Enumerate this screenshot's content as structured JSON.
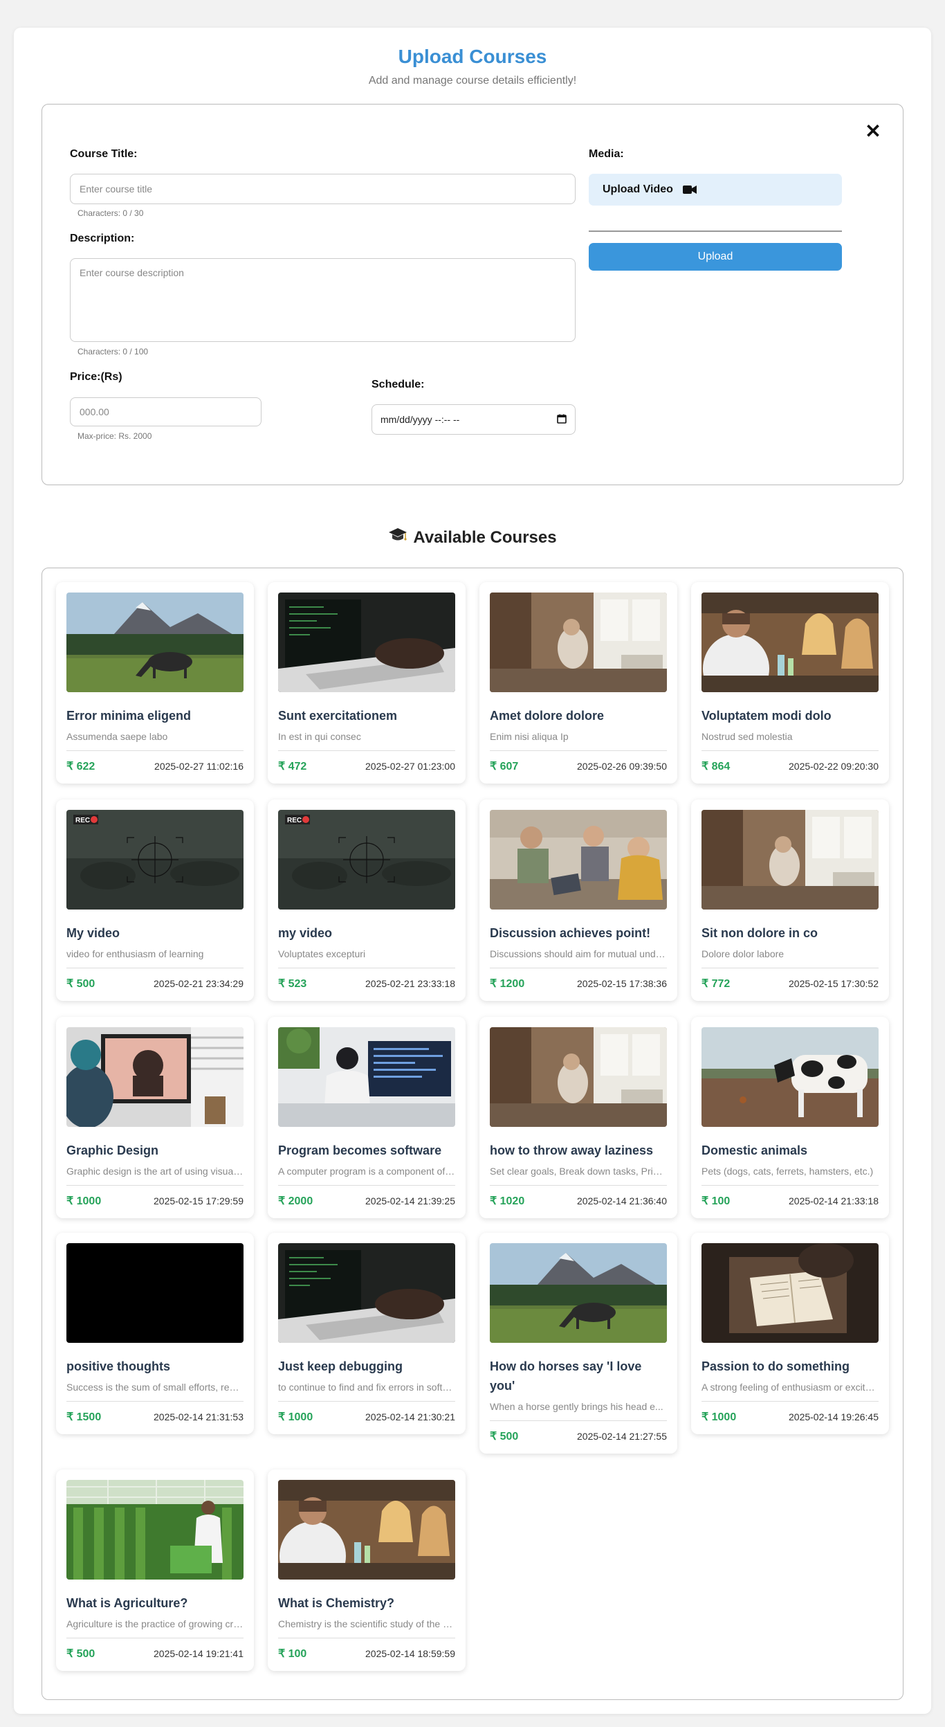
{
  "header": {
    "title": "Upload Courses",
    "subtitle": "Add and manage course details efficiently!"
  },
  "form": {
    "close_label": "✕",
    "course_title_label": "Course Title:",
    "course_title_placeholder": "Enter course title",
    "course_title_hint": "Characters: 0 / 30",
    "description_label": "Description:",
    "description_placeholder": "Enter course description",
    "description_hint": "Characters: 0 / 100",
    "price_label": "Price:(Rs)",
    "price_placeholder": "000.00",
    "price_hint": "Max-price: Rs. 2000",
    "schedule_label": "Schedule:",
    "schedule_value": "mm/dd/yyyy --:-- --",
    "media_label": "Media:",
    "upload_video_label": "Upload Video",
    "upload_button_label": "Upload"
  },
  "courses": {
    "title": "Available Courses",
    "items": [
      {
        "title": "Error minima eligend",
        "desc": "Assumenda saepe labo",
        "price": "₹ 622",
        "date": "2025-02-27 11:02:16",
        "thumb": "horse"
      },
      {
        "title": "Sunt exercitationem",
        "desc": "In est in qui consec",
        "price": "₹ 472",
        "date": "2025-02-27 01:23:00",
        "thumb": "laptop"
      },
      {
        "title": "Amet dolore dolore",
        "desc": "Enim nisi aliqua Ip",
        "price": "₹ 607",
        "date": "2025-02-26 09:39:50",
        "thumb": "room"
      },
      {
        "title": "Voluptatem modi dolo",
        "desc": "Nostrud sed molestia",
        "price": "₹ 864",
        "date": "2025-02-22 09:20:30",
        "thumb": "lab"
      },
      {
        "title": "My video",
        "desc": "video for enthusiasm of learning",
        "price": "₹ 500",
        "date": "2025-02-21 23:34:29",
        "thumb": "rec"
      },
      {
        "title": "my video",
        "desc": "Voluptates excepturi",
        "price": "₹ 523",
        "date": "2025-02-21 23:33:18",
        "thumb": "rec"
      },
      {
        "title": "Discussion achieves point!",
        "desc": "Discussions should aim for mutual understanding",
        "price": "₹ 1200",
        "date": "2025-02-15 17:38:36",
        "thumb": "meeting"
      },
      {
        "title": "Sit non dolore in co",
        "desc": "Dolore dolor labore",
        "price": "₹ 772",
        "date": "2025-02-15 17:30:52",
        "thumb": "room"
      },
      {
        "title": "Graphic Design",
        "desc": "Graphic design is the art of using visual elements",
        "price": "₹ 1000",
        "date": "2025-02-15 17:29:59",
        "thumb": "design"
      },
      {
        "title": "Program becomes software",
        "desc": "A computer program is a component of software",
        "price": "₹ 2000",
        "date": "2025-02-14 21:39:25",
        "thumb": "coder"
      },
      {
        "title": "how to throw away laziness",
        "desc": "Set clear goals, Break down tasks, Prioritize",
        "price": "₹ 1020",
        "date": "2025-02-14 21:36:40",
        "thumb": "room"
      },
      {
        "title": "Domestic animals",
        "desc": "Pets (dogs, cats, ferrets, hamsters, etc.)",
        "price": "₹ 100",
        "date": "2025-02-14 21:33:18",
        "thumb": "cow"
      },
      {
        "title": "positive thoughts",
        "desc": "Success is the sum of small efforts, repeated",
        "price": "₹ 1500",
        "date": "2025-02-14 21:31:53",
        "thumb": "black"
      },
      {
        "title": "Just keep debugging",
        "desc": "to continue to find and fix errors in software",
        "price": "₹ 1000",
        "date": "2025-02-14 21:30:21",
        "thumb": "laptop"
      },
      {
        "title": "How do horses say 'I love you'",
        "desc": "When a horse gently brings his head e...",
        "price": "₹ 500",
        "date": "2025-02-14 21:27:55",
        "thumb": "horse"
      },
      {
        "title": "Passion to do something",
        "desc": "A strong feeling of enthusiasm or excitement",
        "price": "₹ 1000",
        "date": "2025-02-14 19:26:45",
        "thumb": "book"
      },
      {
        "title": "What is Agriculture?",
        "desc": "Agriculture is the practice of growing crops",
        "price": "₹ 500",
        "date": "2025-02-14 19:21:41",
        "thumb": "greenhouse"
      },
      {
        "title": "What is Chemistry?",
        "desc": "Chemistry is the scientific study of the properties",
        "price": "₹ 100",
        "date": "2025-02-14 18:59:59",
        "thumb": "lab"
      }
    ]
  }
}
